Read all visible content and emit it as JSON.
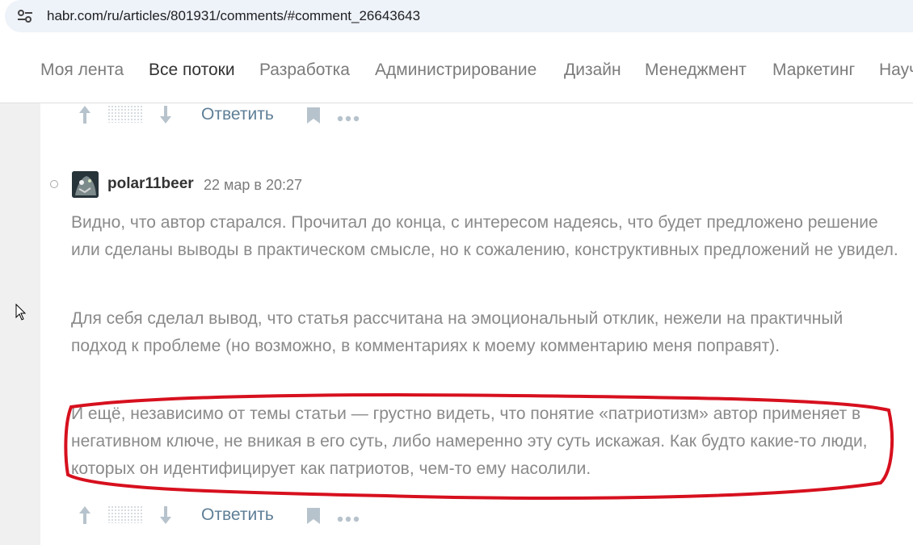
{
  "browser": {
    "url": "habr.com/ru/articles/801931/comments/#comment_26643643",
    "site_info_icon": "tune-icon"
  },
  "nav": {
    "items": [
      {
        "label": "Моя лента",
        "active": false
      },
      {
        "label": "Все потоки",
        "active": true
      },
      {
        "label": "Разработка",
        "active": false
      },
      {
        "label": "Администрирование",
        "active": false
      },
      {
        "label": "Дизайн",
        "active": false
      },
      {
        "label": "Менеджмент",
        "active": false
      },
      {
        "label": "Маркетинг",
        "active": false
      },
      {
        "label": "Научпоп",
        "active": false
      }
    ]
  },
  "previous_comment": {
    "reply_label": "Ответить"
  },
  "comment": {
    "author": "polar11beer",
    "timestamp": "22 мар в 20:27",
    "paragraphs": [
      "Видно, что автор старался. Прочитал до конца, с интересом надеясь, что будет предложено решение или сделаны выводы в практическом смысле, но к сожалению, конструктивных предложений не увидел.",
      "Для себя сделал вывод, что статья рассчитана на эмоциональный отклик, нежели на практичный подход к проблеме (но возможно, в комментариях к моему комментарию меня поправят).",
      "И ещё, независимо от темы статьи — грустно видеть, что понятие «патриотизм» автор применяет в негативном ключе, не вникая в его суть, либо намеренно эту суть искажая. Как будто какие-то люди, которых он идентифицирует как патриотов, чем-то ему насолили."
    ],
    "reply_label": "Ответить",
    "highlight_color": "#d7101e"
  },
  "colors": {
    "link": "#5e7f97",
    "text_muted": "#8a8a8a",
    "active_nav": "#333333"
  }
}
